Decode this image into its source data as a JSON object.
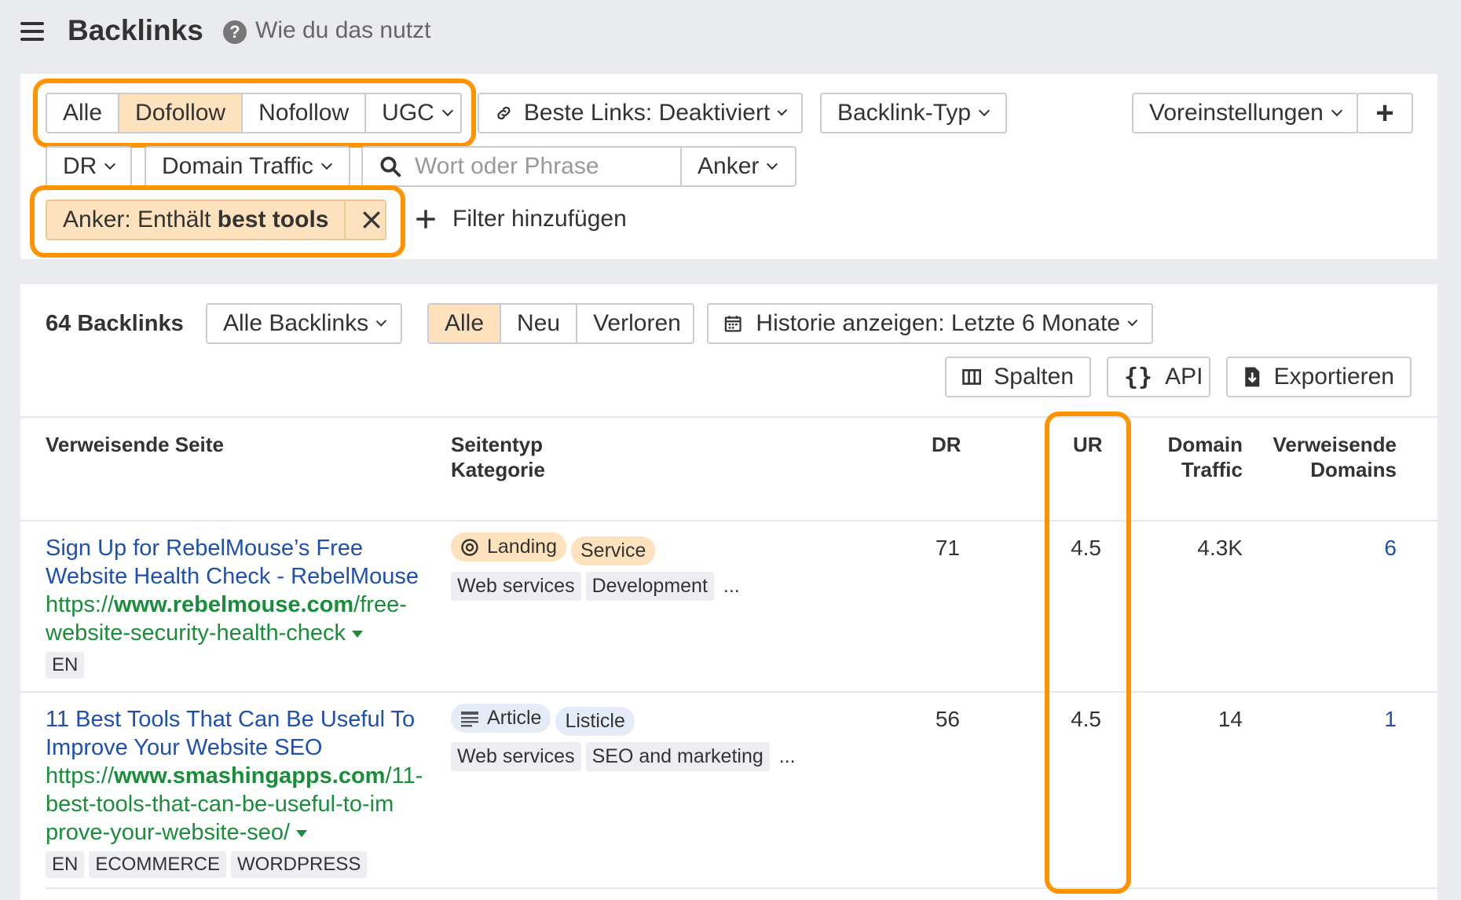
{
  "header": {
    "title": "Backlinks",
    "help_icon": "?",
    "help_text": "Wie du das nutzt"
  },
  "filters": {
    "link_type_tabs": [
      "Alle",
      "Dofollow",
      "Nofollow",
      "UGC"
    ],
    "link_type_selected": "Dofollow",
    "best_links": "Beste Links: Deaktiviert",
    "backlink_type": "Backlink-Typ",
    "presets": "Voreinstellungen",
    "add_icon": "+",
    "dr": "DR",
    "domain_traffic": "Domain Traffic",
    "search_placeholder": "Wort oder Phrase",
    "anchor": "Anker",
    "active_filter_prefix": "Anker: Enthält ",
    "active_filter_value": "best tools",
    "add_filter": "Filter hinzufügen"
  },
  "toolbar": {
    "count": "64 Backlinks",
    "all_backlinks": "Alle Backlinks",
    "status_tabs": [
      "Alle",
      "Neu",
      "Verloren"
    ],
    "status_selected": "Alle",
    "history": "Historie anzeigen: Letzte 6 Monate",
    "columns": "Spalten",
    "api": "API",
    "export": "Exportieren"
  },
  "table": {
    "headers": {
      "referring_page": "Verweisende Seite",
      "page_type_1": "Seitentyp",
      "page_type_2": "Kategorie",
      "dr": "DR",
      "ur": "UR",
      "domain_traffic_1": "Domain",
      "domain_traffic_2": "Traffic",
      "ref_domains_1": "Verweisende",
      "ref_domains_2": "Domains"
    },
    "rows": [
      {
        "title_line1": "Sign Up for RebelMouse’s Free",
        "title_line2": "Website Health Check - RebelMouse",
        "url_prefix": "https://",
        "url_domain": "www.rebelmouse.com",
        "url_rest1": "/free-",
        "url_rest2": "website-security-health-check",
        "tags": [
          "EN"
        ],
        "page_type_icon": "target-icon",
        "page_types": [
          "Landing",
          "Service"
        ],
        "categories": [
          "Web services",
          "Development"
        ],
        "more": "...",
        "dr": "71",
        "ur": "4.5",
        "domain_traffic": "4.3K",
        "ref_domains": "6"
      },
      {
        "title_line1": "11 Best Tools That Can Be Useful To",
        "title_line2": "Improve Your Website SEO",
        "url_prefix": "https://",
        "url_domain": "www.smashingapps.com",
        "url_rest1": "/11-",
        "url_rest2": "best-tools-that-can-be-useful-to-im",
        "url_rest3": "prove-your-website-seo/",
        "tags": [
          "EN",
          "ECOMMERCE",
          "WORDPRESS"
        ],
        "page_type_icon": "article-icon",
        "page_types": [
          "Article",
          "Listicle"
        ],
        "categories": [
          "Web services",
          "SEO and marketing"
        ],
        "more": "...",
        "dr": "56",
        "ur": "4.5",
        "domain_traffic": "14",
        "ref_domains": "1"
      }
    ]
  },
  "colors": {
    "highlight": "#ff9300",
    "active_tab": "#fde2bd",
    "link_blue": "#1e50b0",
    "url_green": "#1a8d3a"
  }
}
